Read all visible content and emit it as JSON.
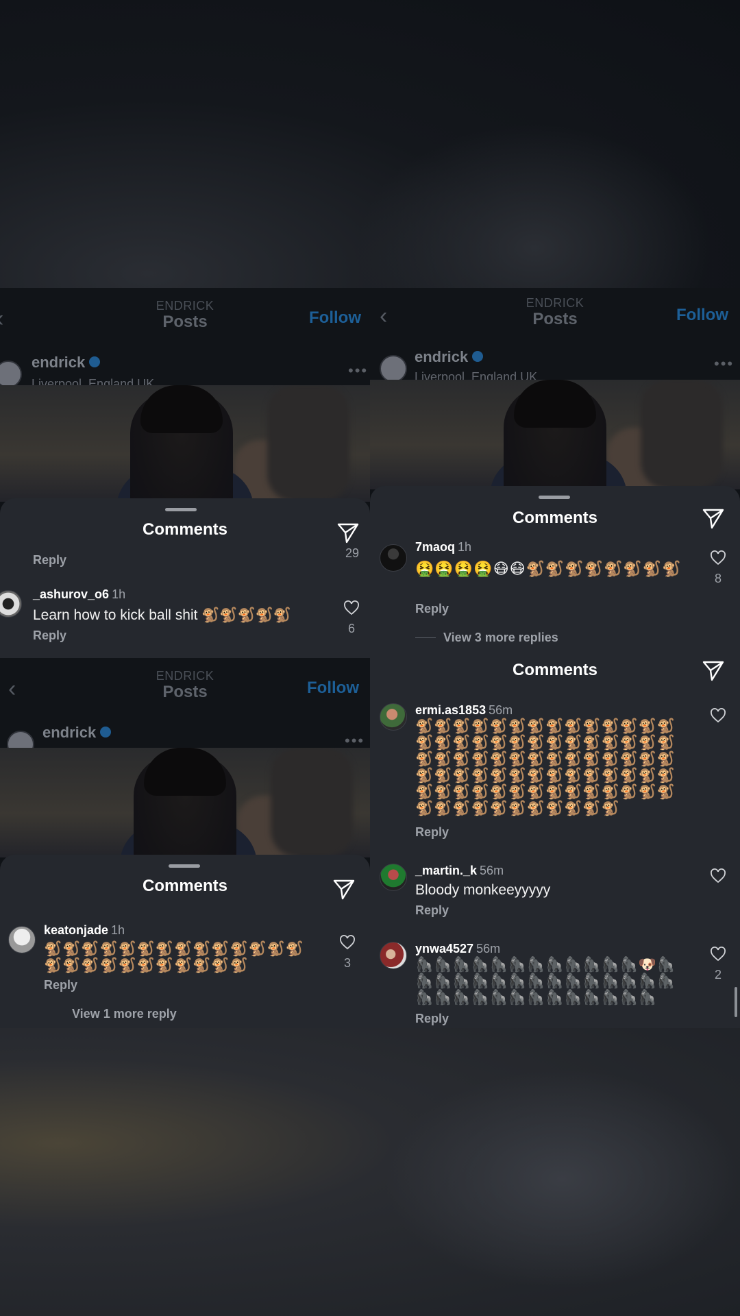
{
  "nav": {
    "sub_title": "ENDRICK",
    "title": "Posts",
    "follow_label": "Follow",
    "back_icon": "chevron-left-icon"
  },
  "profile": {
    "username": "endrick",
    "location": "Liverpool, England UK",
    "more_icon": "ellipsis-icon",
    "verified_icon": "verified-badge-icon"
  },
  "comments_title": "Comments",
  "reply_label": "Reply",
  "panel_a": {
    "partial_reply": "Reply",
    "partial_likes": "29",
    "comment": {
      "user": "_ashurov_o6",
      "time": "1h",
      "text": "Learn how to kick ball shit 🐒🐒🐒🐒🐒",
      "likes": "6"
    }
  },
  "panel_b": {
    "comment": {
      "user": "keatonjade",
      "time": "1h",
      "text": "🐒🐒🐒🐒🐒🐒🐒🐒🐒🐒🐒🐒🐒🐒🐒🐒🐒🐒🐒🐒🐒🐒🐒🐒🐒",
      "likes": "3"
    },
    "view_more": "View 1 more reply"
  },
  "panel_c": {
    "comment": {
      "user": "7maoq",
      "time": "1h",
      "text": "🤮🤮🤮🤮😷😷🐒🐒🐒🐒🐒🐒🐒🐒",
      "likes": "8"
    },
    "view_more": "View 3 more replies"
  },
  "panel_d": {
    "comments": [
      {
        "user": "ermi.as1853",
        "time": "56m",
        "text": "🐒🐒🐒🐒🐒🐒🐒🐒🐒🐒🐒🐒🐒🐒🐒🐒🐒🐒🐒🐒🐒🐒🐒🐒🐒🐒🐒🐒🐒🐒🐒🐒🐒🐒🐒🐒🐒🐒🐒🐒🐒🐒🐒🐒🐒🐒🐒🐒🐒🐒🐒🐒🐒🐒🐒🐒🐒🐒🐒🐒🐒🐒🐒🐒🐒🐒🐒🐒🐒🐒🐒🐒🐒🐒🐒🐒🐒🐒🐒🐒🐒",
        "likes": ""
      },
      {
        "user": "_martin._k",
        "time": "56m",
        "text": "Bloody monkeeyyyyy",
        "likes": ""
      },
      {
        "user": "ynwa4527",
        "time": "56m",
        "text": "🦍🦍🦍🦍🦍🦍🦍🦍🦍🦍🦍🦍🐶🦍🦍🦍🦍🦍🦍🦍🦍🦍🦍🦍🦍🦍🦍🦍🦍🦍🦍🦍🦍🦍🦍🦍🦍🦍🦍🦍🦍",
        "likes": "2"
      }
    ]
  },
  "icons": {
    "send": "paper-plane-icon",
    "heart": "heart-outline-icon",
    "handle": "drag-handle"
  },
  "colors": {
    "accent": "#1d5f97",
    "sheet_bg": "#25282e",
    "muted_text": "#9ea2a9"
  }
}
